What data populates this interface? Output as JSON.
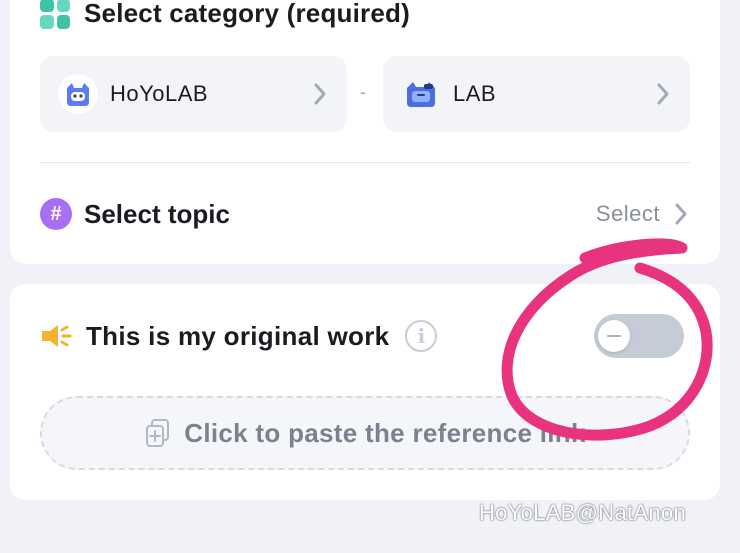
{
  "category": {
    "title": "Select category (required)",
    "first": {
      "label": "HoYoLAB",
      "icon": "hoyolab-mascot-icon"
    },
    "separator": "-",
    "second": {
      "label": "LAB",
      "icon": "lab-mascot-icon"
    }
  },
  "topic": {
    "label": "Select topic",
    "action": "Select",
    "icon": "hashtag-icon"
  },
  "original": {
    "label": "This is my original work",
    "icon": "megaphone-icon",
    "toggle_on": false
  },
  "reference": {
    "button_label": "Click to paste the reference link"
  },
  "watermark": "HoYoLAB@NatAnon",
  "colors": {
    "background": "#f1f2f7",
    "card": "#ffffff",
    "topic_icon": "#a86ff3",
    "megaphone": "#f5b22e",
    "toggle_off": "#c6cbd8",
    "annotation": "#e8347e"
  }
}
